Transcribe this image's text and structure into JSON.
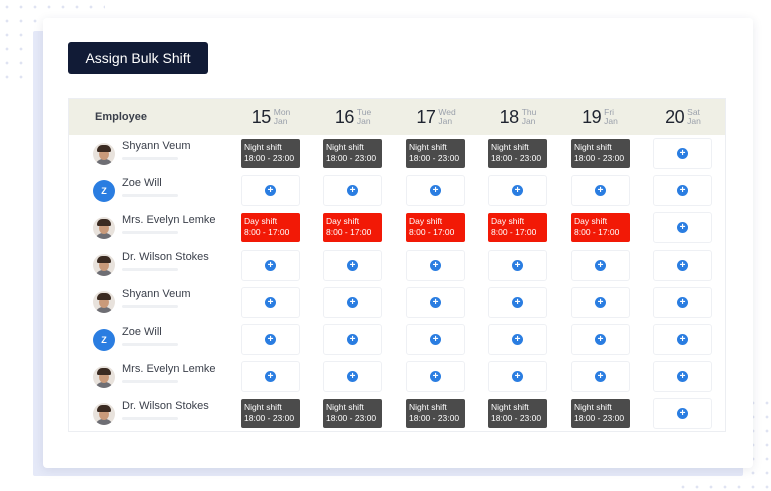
{
  "assign_button_label": "Assign Bulk Shift",
  "header": {
    "employee_label": "Employee",
    "days": [
      {
        "num": "15",
        "weekday": "Mon",
        "month": "Jan"
      },
      {
        "num": "16",
        "weekday": "Tue",
        "month": "Jan"
      },
      {
        "num": "17",
        "weekday": "Wed",
        "month": "Jan"
      },
      {
        "num": "18",
        "weekday": "Thu",
        "month": "Jan"
      },
      {
        "num": "19",
        "weekday": "Fri",
        "month": "Jan"
      },
      {
        "num": "20",
        "weekday": "Sat",
        "month": "Jan"
      }
    ]
  },
  "shift_types": {
    "night": {
      "label": "Night shift",
      "time": "18:00 - 23:00",
      "color": "#4b4b4b"
    },
    "day": {
      "label": "Day shift",
      "time": "8:00 - 17:00",
      "color": "#f21906"
    }
  },
  "add_icon": "plus-circle-icon",
  "accent_color": "#2a7de1",
  "rows": [
    {
      "name": "Shyann Veum",
      "avatar": "photo",
      "initial": "",
      "cells": [
        "night",
        "night",
        "night",
        "night",
        "night",
        "add"
      ]
    },
    {
      "name": "Zoe Will",
      "avatar": "initial",
      "initial": "Z",
      "cells": [
        "add",
        "add",
        "add",
        "add",
        "add",
        "add"
      ]
    },
    {
      "name": "Mrs. Evelyn Lemke",
      "avatar": "photo",
      "initial": "",
      "cells": [
        "day",
        "day",
        "day",
        "day",
        "day",
        "add"
      ]
    },
    {
      "name": "Dr. Wilson Stokes",
      "avatar": "photo",
      "initial": "",
      "cells": [
        "add",
        "add",
        "add",
        "add",
        "add",
        "add"
      ]
    },
    {
      "name": "Shyann Veum",
      "avatar": "photo",
      "initial": "",
      "cells": [
        "add",
        "add",
        "add",
        "add",
        "add",
        "add"
      ]
    },
    {
      "name": "Zoe Will",
      "avatar": "initial",
      "initial": "Z",
      "cells": [
        "add",
        "add",
        "add",
        "add",
        "add",
        "add"
      ]
    },
    {
      "name": "Mrs. Evelyn Lemke",
      "avatar": "photo",
      "initial": "",
      "cells": [
        "add",
        "add",
        "add",
        "add",
        "add",
        "add"
      ]
    },
    {
      "name": "Dr. Wilson Stokes",
      "avatar": "photo",
      "initial": "",
      "cells": [
        "night",
        "night",
        "night",
        "night",
        "night",
        "add"
      ]
    }
  ]
}
